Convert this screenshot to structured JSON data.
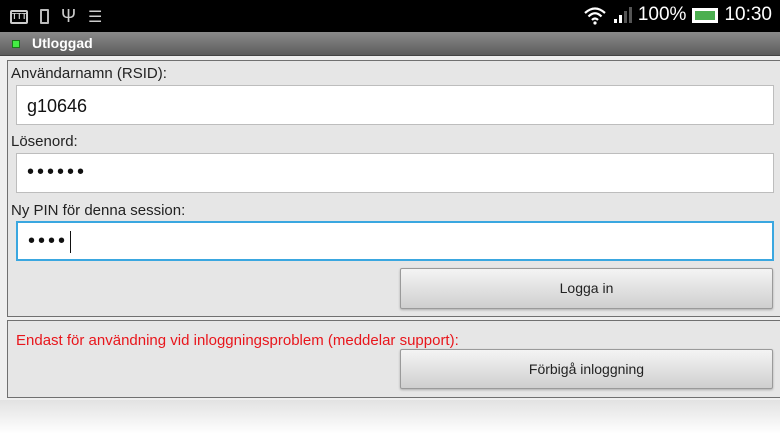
{
  "status_bar": {
    "battery_percent": "100%",
    "time": "10:30",
    "icons": [
      "ttt-icon",
      "phone-icon",
      "usb-icon",
      "android-icon",
      "wifi-icon",
      "signal-icon",
      "battery-icon"
    ]
  },
  "title_bar": {
    "title": "Utloggad",
    "indicator_color": "#44ee44"
  },
  "login": {
    "username_label": "Användarnamn (RSID):",
    "username_value": "g10646",
    "password_label": "Lösenord:",
    "password_value": "••••••",
    "pin_label": "Ny PIN för denna session:",
    "pin_value": "••••",
    "login_button": "Logga in"
  },
  "bypass": {
    "warning_text": "Endast för användning vid inloggningsproblem (meddelar support):",
    "warning_color": "#e8161c",
    "bypass_button": "Förbigå inloggning"
  },
  "colors": {
    "focus_border": "#3aa7e0"
  }
}
